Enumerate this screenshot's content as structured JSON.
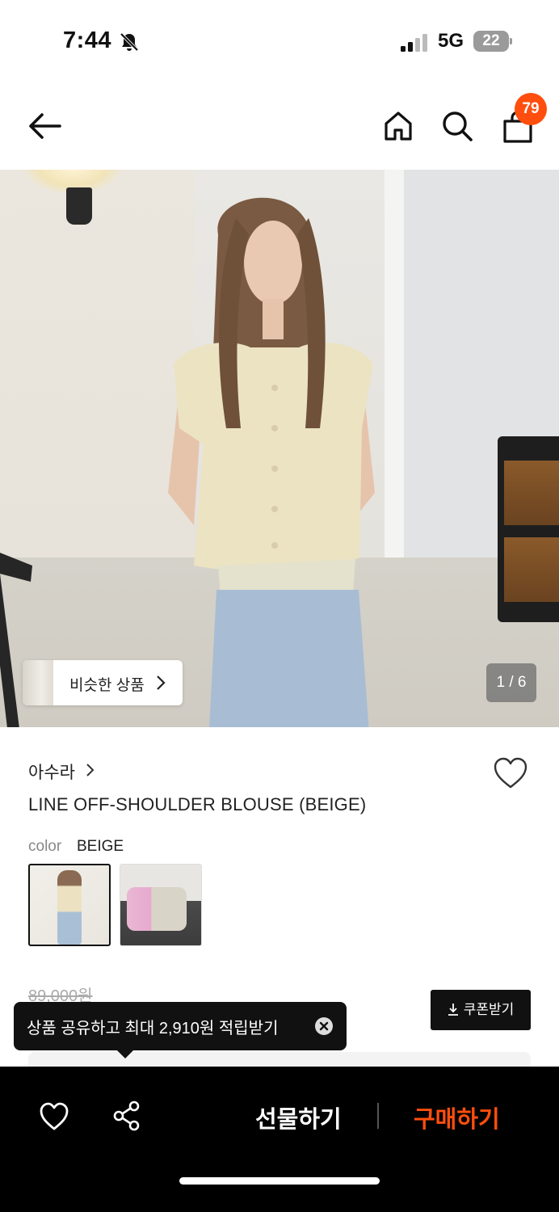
{
  "status_bar": {
    "time": "7:44",
    "network": "5G",
    "battery": "22"
  },
  "header": {
    "cart_count": "79"
  },
  "gallery": {
    "similar_label": "비슷한 상품",
    "pager": "1 / 6"
  },
  "product": {
    "brand": "아수라",
    "title": "LINE OFF-SHOULDER BLOUSE (BEIGE)",
    "option_key": "color",
    "option_value": "BEIGE",
    "original_price": "89,000원"
  },
  "coupon": {
    "label": "쿠폰받기"
  },
  "tooltip": {
    "text": "상품 공유하고 최대 2,910원 적립받기"
  },
  "bottom_bar": {
    "gift_label": "선물하기",
    "buy_label": "구매하기"
  },
  "colors": {
    "accent": "#ff4e0d",
    "dark": "#111111"
  }
}
